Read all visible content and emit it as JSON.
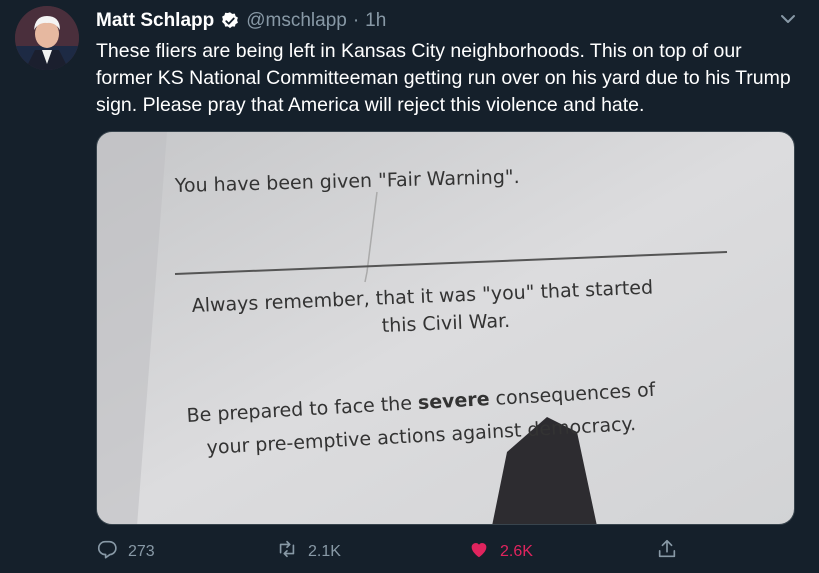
{
  "author": {
    "name": "Matt Schlapp",
    "handle": "@mschlapp",
    "time": "1h"
  },
  "tweet_text": "These fliers are being left in Kansas City neighborhoods. This on top of our former KS National Committeeman getting run over on his yard due to his Trump sign. Please pray that America will reject this violence and hate.",
  "flier": {
    "line1": "You have been given \"Fair Warning\".",
    "line2": "Always remember, that it was \"you\" that started",
    "line3": "this Civil War.",
    "line4_pre": "Be prepared to face the ",
    "line4_bold": "severe",
    "line4_post": " consequences of",
    "line5": "your pre-emptive actions against democracy."
  },
  "actions": {
    "replies": "273",
    "retweets": "2.1K",
    "likes": "2.6K"
  },
  "colors": {
    "background": "#15202b",
    "muted": "#8899a6",
    "like": "#e0245e",
    "verified": "#ffffff"
  },
  "icons": [
    "avatar",
    "verified-badge-icon",
    "chevron-down-icon",
    "reply-icon",
    "retweet-icon",
    "heart-icon",
    "share-icon"
  ]
}
